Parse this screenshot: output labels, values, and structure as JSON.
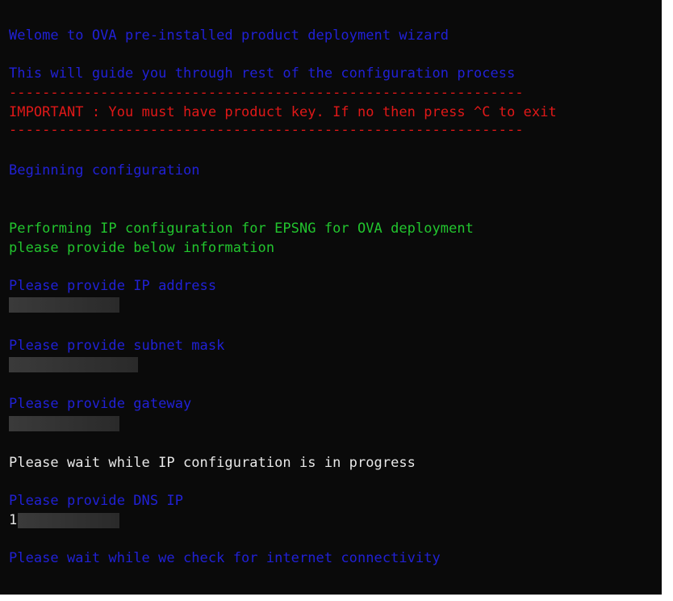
{
  "terminal": {
    "welcome": "Welome to OVA pre-installed product deployment wizard",
    "guide": "This will guide you through rest of the configuration process",
    "divider_top": "--------------------------------------------------------------",
    "important_label": "IMPORTANT :",
    "important_text": " You must have product key. If no then press ^C to exit",
    "divider_bottom": "--------------------------------------------------------------",
    "beginning": "Beginning configuration",
    "performing": "Performing IP configuration for EPSNG for OVA deployment",
    "provide_below": "please provide below information",
    "prompt_ip": "Please provide IP address",
    "prompt_subnet": "Please provide subnet mask",
    "prompt_gateway": "Please provide gateway",
    "wait_ip": "Please wait while IP configuration is in progress",
    "prompt_dns": "Please provide DNS IP",
    "dns_first_char": "1",
    "wait_internet": "Please wait while we check for internet connectivity"
  },
  "colors": {
    "background": "#0a0a0a",
    "prompt_blue": "#2121d6",
    "important_red": "#e01818",
    "info_green": "#22c52e",
    "plain_white": "#e8e8e8"
  }
}
